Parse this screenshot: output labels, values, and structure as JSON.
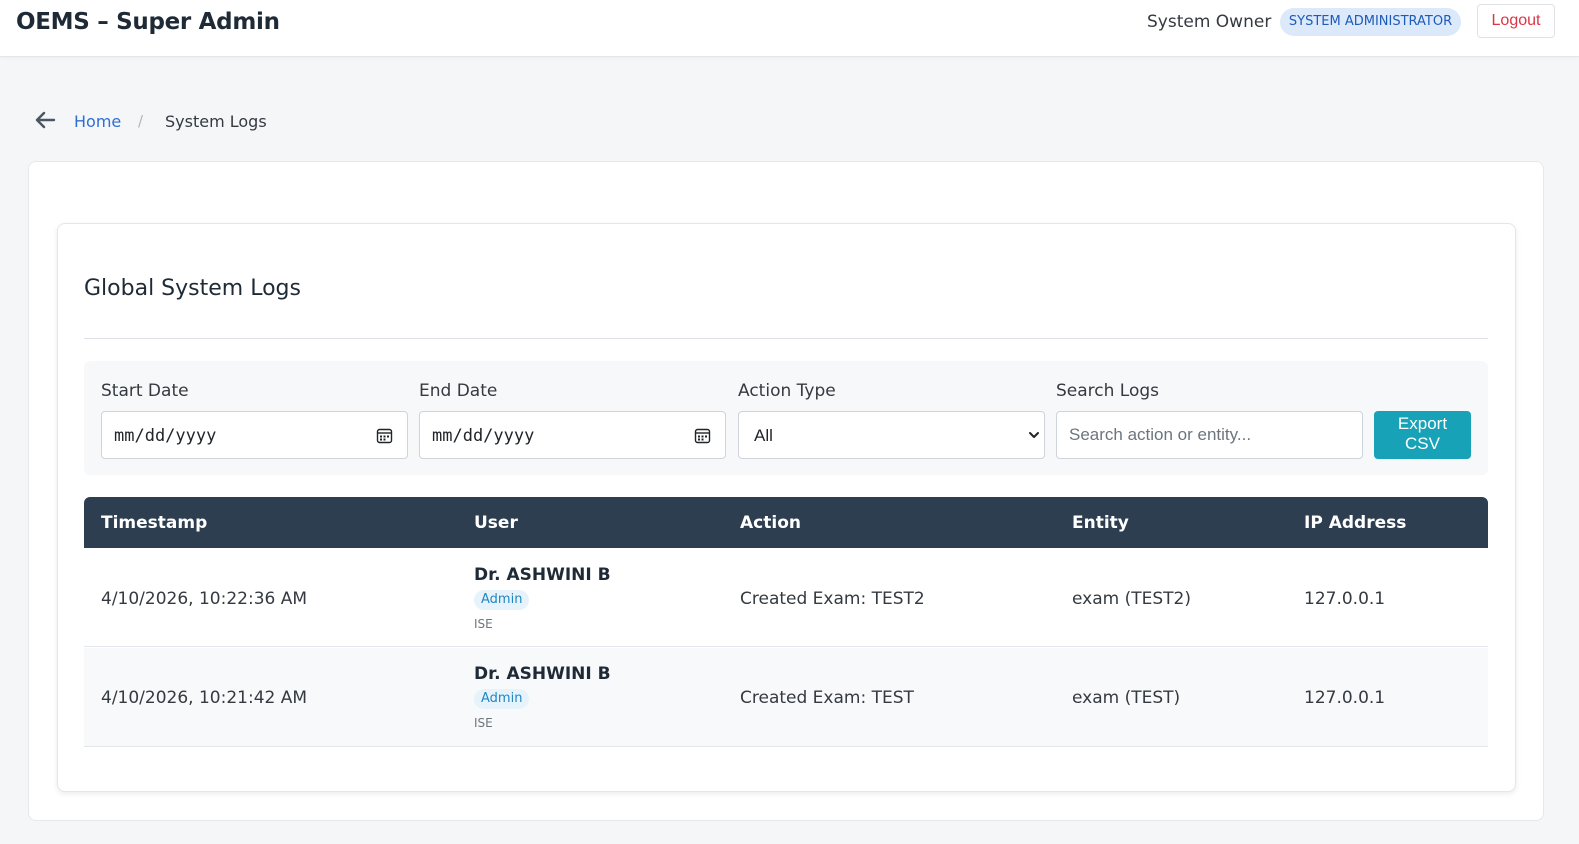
{
  "header": {
    "brand": "OEMS – Super Admin",
    "user_name": "System Owner",
    "role_badge": "SYSTEM ADMINISTRATOR",
    "logout_label": "Logout"
  },
  "breadcrumb": {
    "back_icon": "arrow-left-icon",
    "home": "Home",
    "separator": "/",
    "current": "System Logs"
  },
  "card": {
    "title": "Global System Logs"
  },
  "filters": {
    "start_date": {
      "label": "Start Date",
      "placeholder": "mm/dd/yyyy"
    },
    "end_date": {
      "label": "End Date",
      "placeholder": "mm/dd/yyyy"
    },
    "action_type": {
      "label": "Action Type",
      "selected": "All"
    },
    "search": {
      "label": "Search Logs",
      "placeholder": "Search action or entity..."
    },
    "export": {
      "line1": "Export",
      "line2": "CSV"
    }
  },
  "table": {
    "columns": [
      "Timestamp",
      "User",
      "Action",
      "Entity",
      "IP Address"
    ],
    "rows": [
      {
        "timestamp": "4/10/2026, 10:22:36 AM",
        "user": {
          "name": "Dr. ASHWINI B",
          "role": "Admin",
          "dept": "ISE"
        },
        "action": "Created Exam: TEST2",
        "entity": "exam (TEST2)",
        "ip": "127.0.0.1"
      },
      {
        "timestamp": "4/10/2026, 10:21:42 AM",
        "user": {
          "name": "Dr. ASHWINI B",
          "role": "Admin",
          "dept": "ISE"
        },
        "action": "Created Exam: TEST",
        "entity": "exam (TEST)",
        "ip": "127.0.0.1"
      }
    ]
  },
  "colors": {
    "table_header_bg": "#2c3e50",
    "export_button": "#17a2b8",
    "logout_text": "#dc3545",
    "link": "#2f6fd1",
    "role_badge_bg": "#dbe9fb"
  }
}
